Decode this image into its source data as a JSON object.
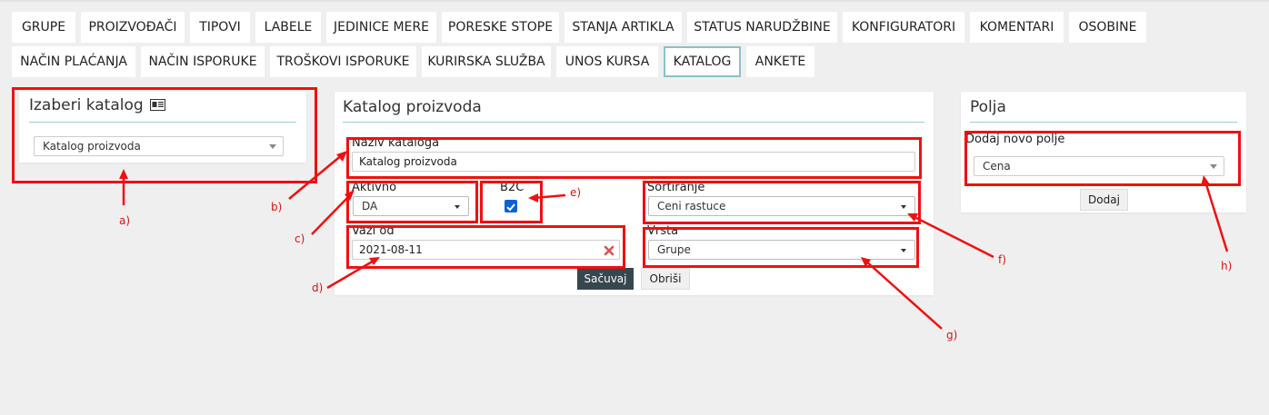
{
  "tabs_row1": [
    "GRUPE",
    "PROIZVOĐAČI",
    "TIPOVI",
    "LABELE",
    "JEDINICE MERE",
    "PORESKE STOPE",
    "STANJA ARTIKLA",
    "STATUS NARUDŽBINE",
    "KONFIGURATORI",
    "KOMENTARI",
    "OSOBINE"
  ],
  "tabs_row2": [
    "NAČIN PLAĆANJA",
    "NAČIN ISPORUKE",
    "TROŠKOVI ISPORUKE",
    "KURIRSKA SLUŽBA",
    "UNOS KURSA",
    "KATALOG",
    "ANKETE"
  ],
  "active_tab": "KATALOG",
  "choose_panel": {
    "title": "Izaberi katalog",
    "title_icon": "catalog-card-icon",
    "select_value": "Katalog proizvoda"
  },
  "form_panel": {
    "title": "Katalog proizvoda",
    "name_label": "Naziv kataloga",
    "name_value": "Katalog proizvoda",
    "active_label": "Aktivno",
    "active_value": "DA",
    "b2c_label": "B2C",
    "b2c_checked": true,
    "sort_label": "Sortiranje",
    "sort_value": "Ceni rastuce",
    "valid_label": "Vazi od",
    "valid_value": "2021-08-11",
    "type_label": "Vrsta",
    "type_value": "Grupe",
    "save_label": "Sačuvaj",
    "delete_label": "Obriši"
  },
  "fields_panel": {
    "title": "Polja",
    "add_label": "Dodaj novo polje",
    "select_value": "Cena",
    "add_button": "Dodaj"
  },
  "annotations": [
    "a)",
    "b)",
    "c)",
    "d)",
    "e)",
    "f)",
    "g)",
    "h)"
  ],
  "colors": {
    "annotation_red": "#f01010",
    "active_tab_border": "#8fbfca",
    "title_rule": "#9ccbd3",
    "save_button": "#37474f",
    "checkbox": "#0b62d6",
    "clear_icon": "#d9534f"
  }
}
